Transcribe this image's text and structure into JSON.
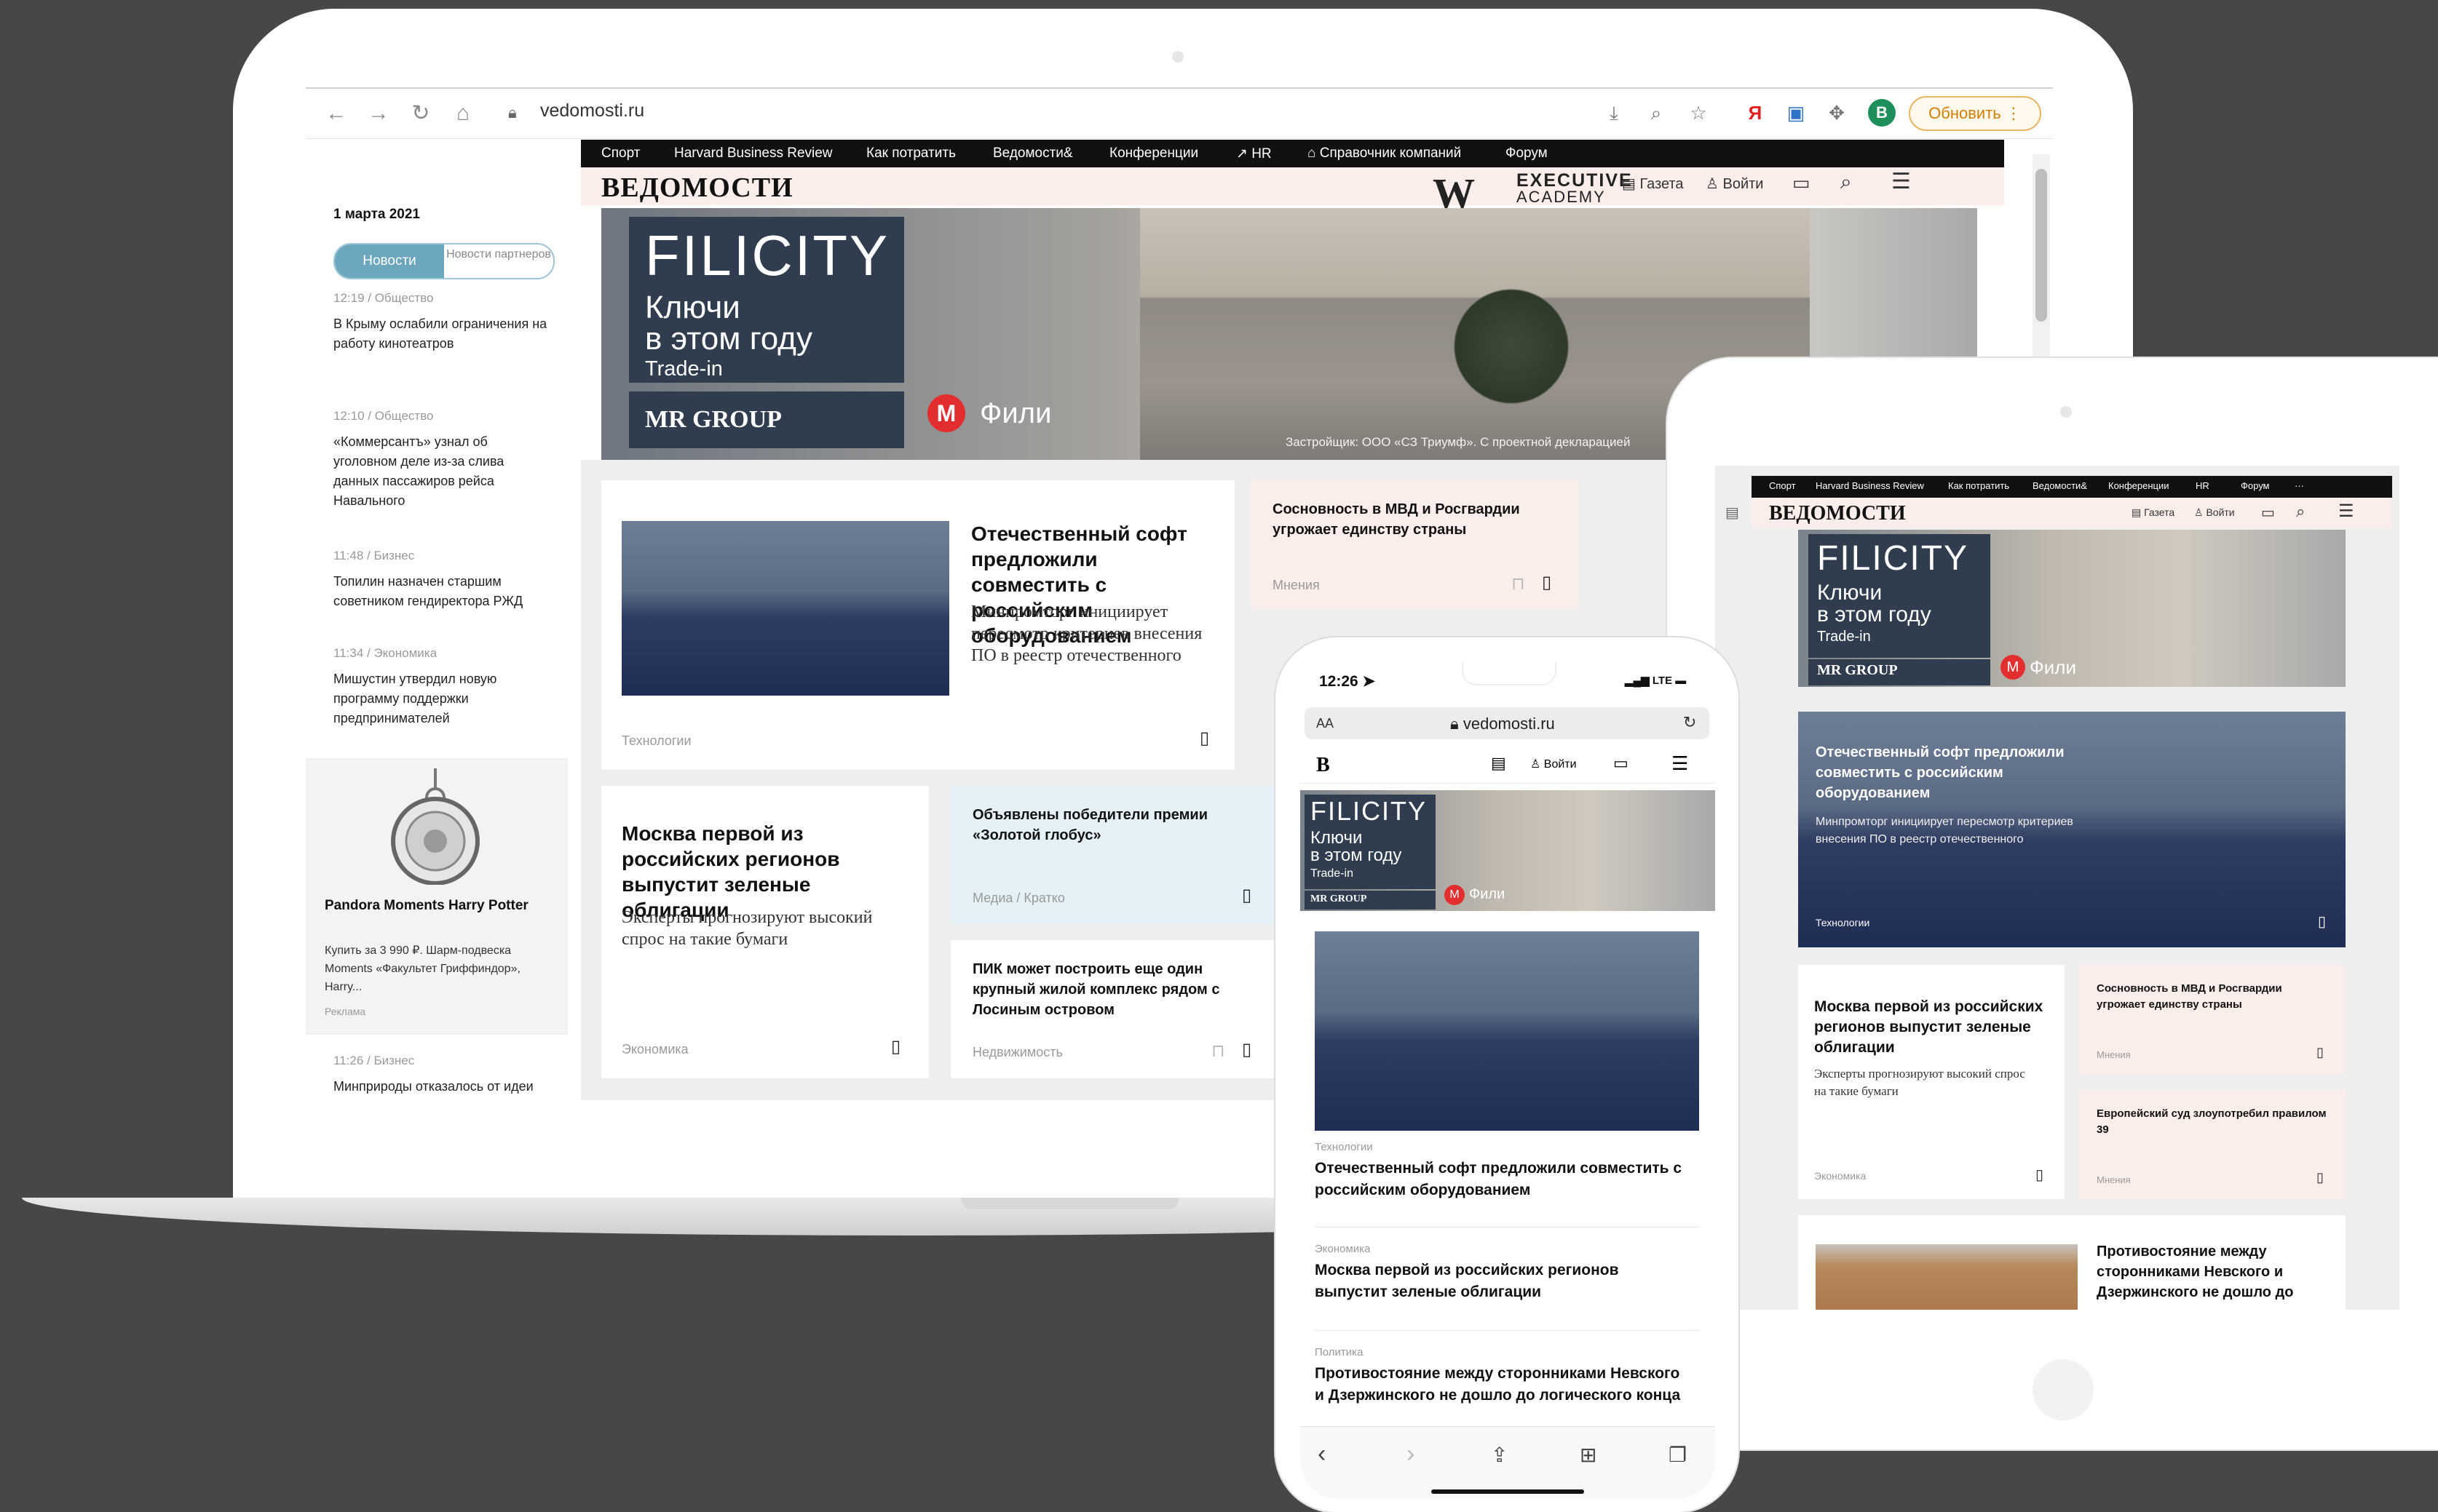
{
  "browser": {
    "url": "vedomosti.ru",
    "update_label": "Обновить",
    "avatar_letter": "В",
    "nav_icons": [
      "back-icon",
      "forward-icon",
      "reload-icon",
      "home-icon"
    ]
  },
  "site": {
    "topnav": [
      "Спорт",
      "Harvard Business Review",
      "Как потратить",
      "Ведомости&",
      "Конференции",
      "HR",
      "Справочник компаний",
      "Форум"
    ],
    "logo": "ВЕДОМОСТИ",
    "exec_logo": "W",
    "exec_line1": "EXECUTIVE",
    "exec_line2": "ACADEMY",
    "header_newspaper": "Газета",
    "header_login": "Войти"
  },
  "banner": {
    "brand": "FILICITY",
    "line1": "Ключи",
    "line2": "в этом году",
    "line3": "Trade-in",
    "developer": "MR GROUP",
    "metro_letter": "М",
    "station": "Фили",
    "note": "Застройщик: ООО «СЗ Триумф». С проектной декларацией"
  },
  "sidebar": {
    "date": "1 марта 2021",
    "tab_news": "Новости",
    "tab_partners": "Новости партнеров",
    "feed": [
      {
        "meta": "12:19 / Общество",
        "title": "В Крыму ослабили ограничения на работу кинотеатров"
      },
      {
        "meta": "12:10 / Общество",
        "title": "«Коммерсантъ» узнал об уголовном деле из-за слива данных пассажиров рейса Навального"
      },
      {
        "meta": "11:48 / Бизнес",
        "title": "Топилин назначен старшим советником гендиректора РЖД"
      },
      {
        "meta": "11:34 / Экономика",
        "title": "Мишустин утвердил новую программу поддержки предпринимателей"
      }
    ],
    "ad": {
      "title": "Pandora Moments Harry Potter",
      "text": "Купить за 3 990 ₽. Шарм-подвеска Moments «Факультет Гриффиндор», Harry...",
      "label": "Реклама"
    },
    "feed_last": {
      "meta": "11:26 / Бизнес",
      "title": "Минприроды отказалось от идеи ограничивать дивиденды за ущерб природе"
    }
  },
  "cards": {
    "main": {
      "title": "Отечественный софт предложили совместить с российским оборудованием",
      "lead": "Минпромторг инициирует пересмотр критериев внесения ПО в реестр отечественного",
      "rubric": "Технологии"
    },
    "opinion": {
      "title": "Сосновность в МВД и Росгвардии угрожает единству страны",
      "rubric": "Мнения"
    },
    "moscow": {
      "title": "Москва первой из российских регионов выпустит зеленые облигации",
      "lead": "Эксперты прогнозируют высокий спрос на такие бумаги",
      "rubric": "Экономика"
    },
    "globes": {
      "title": "Объявлены победители премии «Золотой глобус»",
      "rubric": "Медиа / Кратко"
    },
    "pik": {
      "title": "ПИК может построить еще один крупный жилой комплекс рядом с Лосиным островом",
      "rubric": "Недвижимость"
    }
  },
  "tablet": {
    "topnav": [
      "Спорт",
      "Harvard Business Review",
      "Как потратить",
      "Ведомости&",
      "Конференции",
      "HR",
      "Форум",
      "···"
    ],
    "logo": "ВЕДОМОСТИ",
    "header_newspaper": "Газета",
    "header_login": "Войти",
    "hero_title": "Отечественный софт предложили совместить с российским оборудованием",
    "hero_lead": "Минпромторг инициирует пересмотр критериев внесения ПО в реестр отечественного",
    "hero_rubric": "Технологии",
    "card_moscow_title": "Москва первой из российских регионов выпустит зеленые облигации",
    "card_moscow_lead": "Эксперты прогнозируют высокий спрос на такие бумаги",
    "card_moscow_rubric": "Экономика",
    "opinion1_title": "Сосновность в МВД и Росгвардии угрожает единству страны",
    "opinion1_rubric": "Мнения",
    "opinion2_title": "Европейский суд злоупотребил правилом 39",
    "opinion2_rubric": "Мнения",
    "last_title": "Противостояние между сторонниками Невского и Дзержинского не дошло до"
  },
  "phone": {
    "time": "12:26",
    "network": "LTE",
    "aa": "AA",
    "url": "vedomosti.ru",
    "logo": "В",
    "login": "Войти",
    "items": [
      {
        "rubric": "Технологии",
        "title": "Отечественный софт предложили совместить с российским оборудованием"
      },
      {
        "rubric": "Экономика",
        "title": "Москва первой из российских регионов выпустит зеленые облигации"
      },
      {
        "rubric": "Политика",
        "title": "Противостояние между сторонниками Невского и Дзержинского не дошло до логического конца"
      }
    ]
  }
}
